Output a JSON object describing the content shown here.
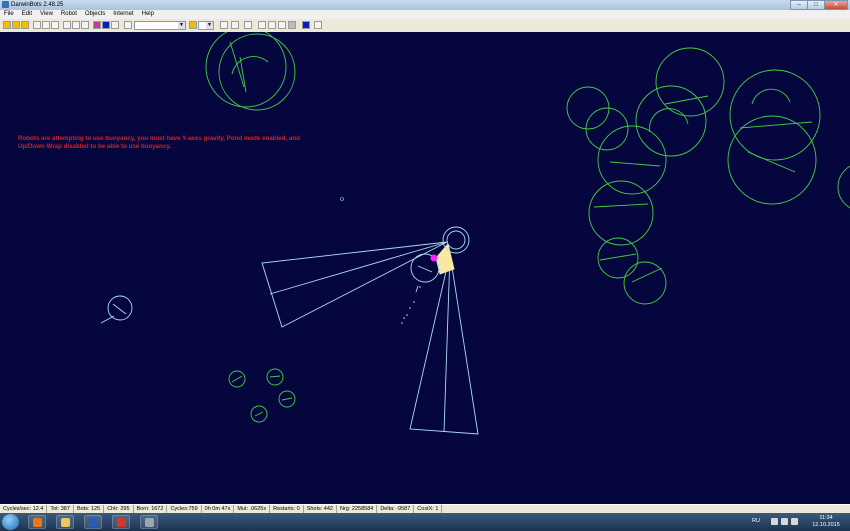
{
  "window": {
    "title": "DarwinBots 2.48.25",
    "buttons": {
      "minimize": "–",
      "maximize": "□",
      "close": "✕"
    }
  },
  "menu": [
    "File",
    "Edit",
    "View",
    "Robot",
    "Objects",
    "Internet",
    "Help"
  ],
  "toolbar": {
    "icons": [
      "new-icon",
      "open-icon",
      "save-icon",
      "play-icon",
      "cycle-icon",
      "pause-icon",
      "single-step-icon",
      "arrow-left-icon",
      "arrow-right-icon",
      "target-icon",
      "color-swatch-icon",
      "select-icon"
    ],
    "combo1_value": "",
    "combo2_value": "",
    "colors": {
      "toolbar_bg": "#ece9d8",
      "arena_bg": "#06063e"
    }
  },
  "arena": {
    "warning_text": "Robots are attempting to use buoyancy, you must have Y-axes gravity, Pond mode enabled, and Up/Down Wrap disabled to be able to use buoyancy.",
    "colors": {
      "bot_green": "#44cc44",
      "bot_cyan": "#aaddee",
      "warning_red": "#d42020",
      "highlight_magenta": "#ff20ff",
      "beam_yellow": "#f8e8a0"
    }
  },
  "status": [
    "Cycles/sec: 12.4",
    "Tot: 387",
    "Bots: 125",
    "Chlr: 295",
    "Born: 1672",
    "Cycles:759",
    "0h 0m 47s",
    "Mut: .0625x",
    "Restarts: 0",
    "Shots: 442",
    "Nrg: 2258584",
    "Delta: -9587",
    "CostX: 1"
  ],
  "taskbar": {
    "apps": [
      "firefox-icon",
      "explorer-icon",
      "word-icon",
      "darwinbots-icon",
      "app-icon"
    ],
    "language": "RU",
    "time": "11:34",
    "date": "12.10.2015"
  }
}
